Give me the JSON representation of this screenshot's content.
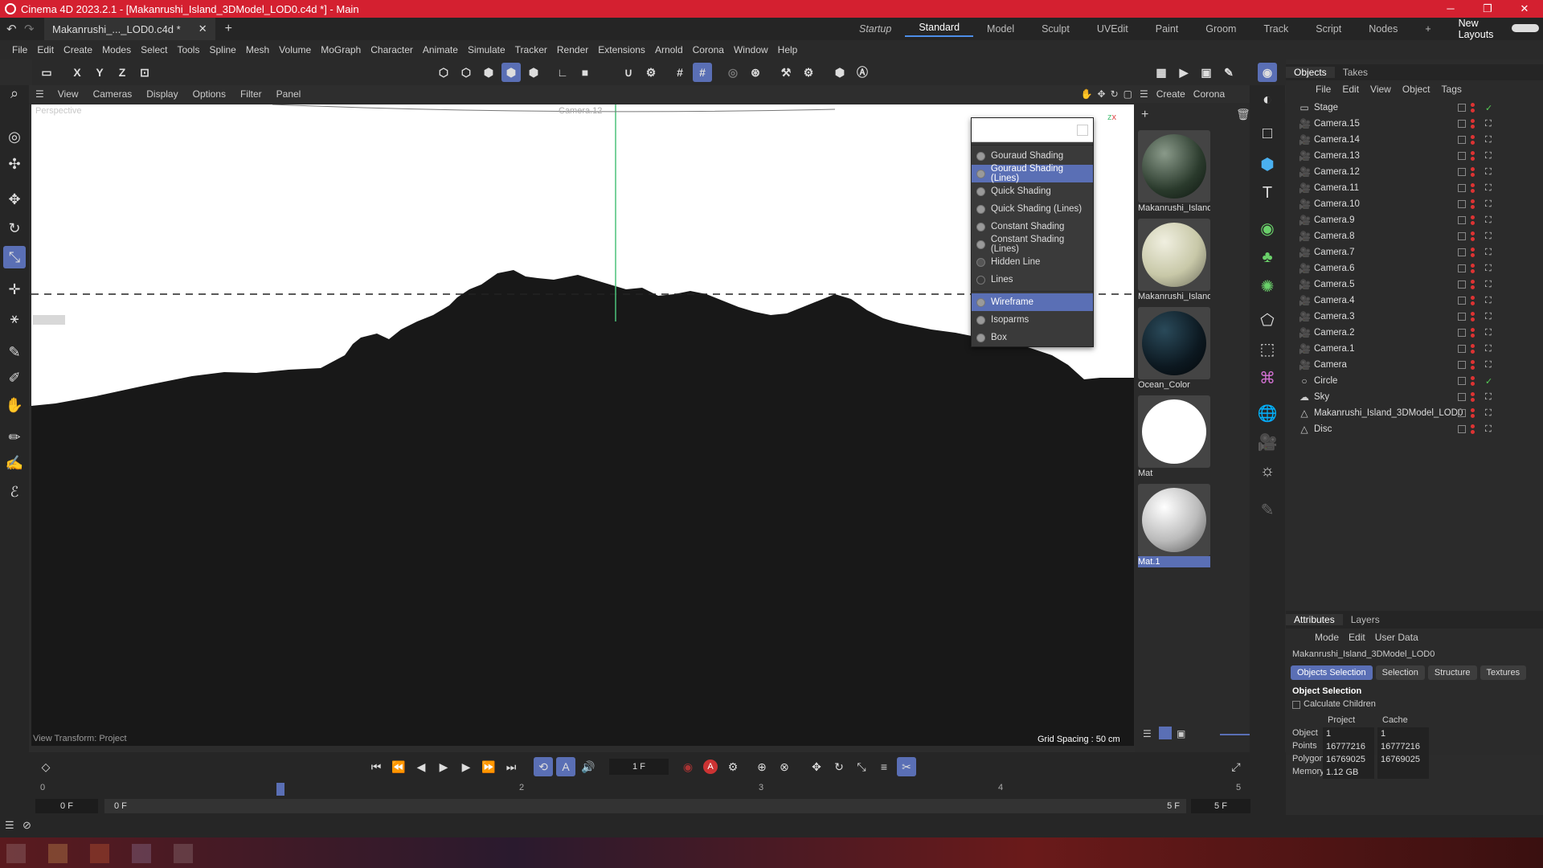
{
  "window": {
    "title": "Cinema 4D 2023.2.1 - [Makanrushi_Island_3DModel_LOD0.c4d *] - Main",
    "doc_tab": "Makanrushi_..._LOD0.c4d *",
    "minimize": "─",
    "maximize": "❐",
    "close": "✕"
  },
  "layouts": [
    "Startup",
    "Standard",
    "Model",
    "Sculpt",
    "UVEdit",
    "Paint",
    "Groom",
    "Track",
    "Script",
    "Nodes"
  ],
  "new_layouts": "New Layouts",
  "menu": [
    "File",
    "Edit",
    "Create",
    "Modes",
    "Select",
    "Tools",
    "Spline",
    "Mesh",
    "Volume",
    "MoGraph",
    "Character",
    "Animate",
    "Simulate",
    "Tracker",
    "Render",
    "Extensions",
    "Arnold",
    "Corona",
    "Window",
    "Help"
  ],
  "toolbar": {
    "x": "X",
    "y": "Y",
    "z": "Z"
  },
  "viewport": {
    "menu": [
      "View",
      "Cameras",
      "Display",
      "Options",
      "Filter",
      "Panel"
    ],
    "label": "Perspective",
    "camera_label": "Camera.12",
    "grid_spacing": "Grid Spacing : 50 cm",
    "view_transform": "View Transform: Project"
  },
  "shading_menu": {
    "items": [
      "Gouraud Shading",
      "Gouraud Shading (Lines)",
      "Quick Shading",
      "Quick Shading (Lines)",
      "Constant Shading",
      "Constant Shading (Lines)",
      "Hidden Line",
      "Lines"
    ],
    "items2": [
      "Wireframe",
      "Isoparms",
      "Box"
    ],
    "highlight_color": "#5a6fb5"
  },
  "materials": {
    "menu": [
      "Create",
      "Corona"
    ],
    "items": [
      "Makanrushi_Island",
      "Makanrushi_Island",
      "Ocean_Color",
      "Mat",
      "Mat.1"
    ]
  },
  "objects": {
    "tabs": [
      "Objects",
      "Takes"
    ],
    "menu": [
      "File",
      "Edit",
      "View",
      "Object",
      "Tags"
    ],
    "rows": [
      "Stage",
      "Camera.15",
      "Camera.14",
      "Camera.13",
      "Camera.12",
      "Camera.11",
      "Camera.10",
      "Camera.9",
      "Camera.8",
      "Camera.7",
      "Camera.6",
      "Camera.5",
      "Camera.4",
      "Camera.3",
      "Camera.2",
      "Camera.1",
      "Camera",
      "Circle",
      "Sky",
      "Makanrushi_Island_3DModel_LOD0",
      "Disc"
    ]
  },
  "attributes": {
    "tabs": [
      "Attributes",
      "Layers"
    ],
    "menu": [
      "Mode",
      "Edit",
      "User Data"
    ],
    "object_name": "Makanrushi_Island_3DModel_LOD0",
    "pills": [
      "Objects Selection",
      "Selection",
      "Structure",
      "Textures"
    ],
    "section": "Object Selection",
    "calc_children": "Calculate Children",
    "col_project": "Project",
    "col_cache": "Cache",
    "rows": [
      {
        "label": "Object",
        "project": "1",
        "cache": "1"
      },
      {
        "label": "Points",
        "project": "16777216",
        "cache": "16777216"
      },
      {
        "label": "Polygons",
        "project": "16769025",
        "cache": "16769025"
      },
      {
        "label": "Memory",
        "project": "1.12 GB",
        "cache": ""
      }
    ]
  },
  "timeline": {
    "current_frame": "1 F",
    "start": "0 F",
    "start2": "0 F",
    "end": "5 F",
    "end2": "5 F",
    "ticks": [
      "0",
      "1",
      "2",
      "3",
      "4",
      "5"
    ],
    "autokey": "A"
  }
}
